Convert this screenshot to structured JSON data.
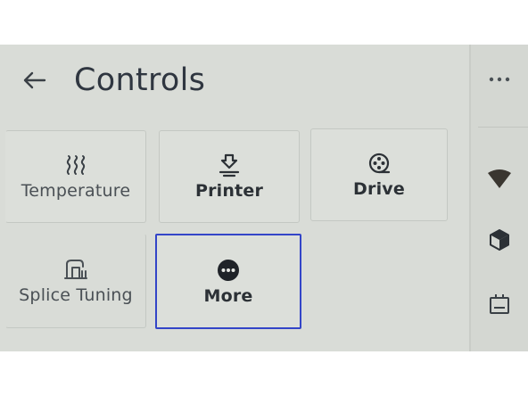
{
  "header": {
    "title": "Controls",
    "back_icon": "arrow-left-icon"
  },
  "tiles": [
    {
      "label": "Temperature",
      "icon": "heat-waves-icon"
    },
    {
      "label": "Printer",
      "icon": "printer-icon"
    },
    {
      "label": "Drive",
      "icon": "drive-reel-icon"
    },
    {
      "label": "Splice Tuning",
      "icon": "splice-tuning-icon"
    },
    {
      "label": "More",
      "icon": "more-dots-icon",
      "selected": true
    }
  ],
  "sidebar": {
    "items": [
      {
        "icon": "more-horizontal-icon"
      },
      {
        "icon": "wifi-icon"
      },
      {
        "icon": "cube-icon"
      },
      {
        "icon": "storage-icon"
      }
    ]
  },
  "colors": {
    "screen_bg": "#d9dcd7",
    "text": "#2e3338",
    "selection": "#3345c8"
  }
}
